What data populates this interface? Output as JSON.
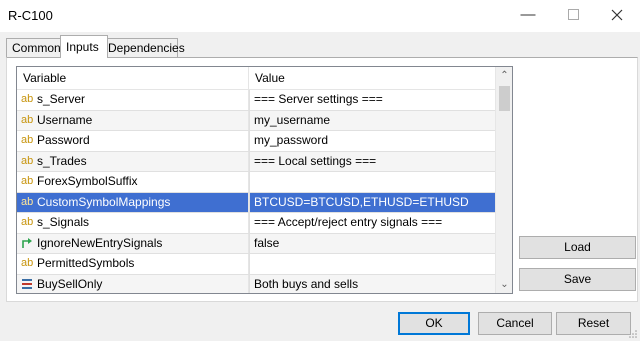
{
  "window": {
    "title": "R-C100"
  },
  "tabs": [
    {
      "label": "Common"
    },
    {
      "label": "Inputs"
    },
    {
      "label": "Dependencies"
    }
  ],
  "grid": {
    "headers": {
      "variable": "Variable",
      "value": "Value"
    },
    "rows": [
      {
        "icon": "ab",
        "name": "s_Server",
        "value": "=== Server settings ==="
      },
      {
        "icon": "ab",
        "name": "Username",
        "value": "my_username"
      },
      {
        "icon": "ab",
        "name": "Password",
        "value": "my_password"
      },
      {
        "icon": "ab",
        "name": "s_Trades",
        "value": "=== Local settings ==="
      },
      {
        "icon": "ab",
        "name": "ForexSymbolSuffix",
        "value": ""
      },
      {
        "icon": "ab",
        "name": "CustomSymbolMappings",
        "value": "BTCUSD=BTCUSD,ETHUSD=ETHUSD"
      },
      {
        "icon": "ab",
        "name": "s_Signals",
        "value": "=== Accept/reject entry signals ==="
      },
      {
        "icon": "bool-arrow-icon",
        "name": "IgnoreNewEntrySignals",
        "value": "false"
      },
      {
        "icon": "ab",
        "name": "PermittedSymbols",
        "value": ""
      },
      {
        "icon": "enum-list-icon",
        "name": "BuySellOnly",
        "value": "Both buys and sells"
      }
    ]
  },
  "side_buttons": {
    "load": "Load",
    "save": "Save"
  },
  "footer_buttons": {
    "ok": "OK",
    "cancel": "Cancel",
    "reset": "Reset"
  },
  "colors": {
    "selection": "#3f6fd1",
    "ab_icon": "#c7940d",
    "bool_icon": "#2ea44f"
  }
}
